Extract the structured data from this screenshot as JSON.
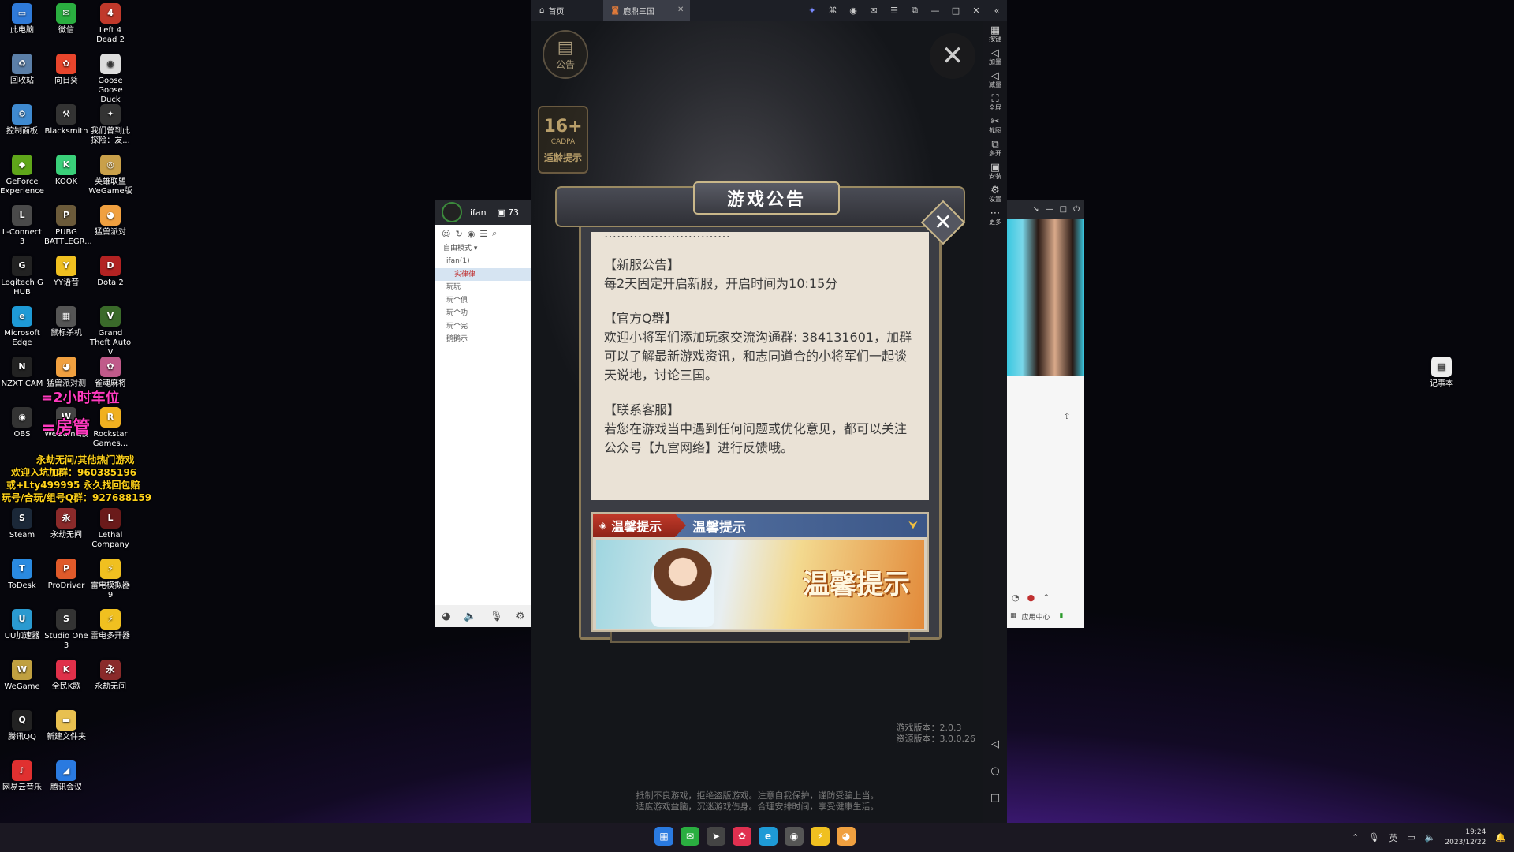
{
  "desktop": {
    "icons": [
      {
        "label": "此电脑",
        "glyph": "▭",
        "color": "#2f7ad8"
      },
      {
        "label": "微信",
        "glyph": "✉",
        "color": "#2aae40"
      },
      {
        "label": "Left 4 Dead 2",
        "glyph": "4",
        "color": "#c0392b"
      },
      {
        "label": "回收站",
        "glyph": "♻",
        "color": "#5b7fa8"
      },
      {
        "label": "向日葵",
        "glyph": "✿",
        "color": "#e8452c"
      },
      {
        "label": "Goose Goose Duck",
        "glyph": "◉",
        "color": "#ddd"
      },
      {
        "label": "控制面板",
        "glyph": "⚙",
        "color": "#3f8ad0"
      },
      {
        "label": "Blacksmith",
        "glyph": "⚒",
        "color": "#333"
      },
      {
        "label": "我们曾到此探险：友...",
        "glyph": "✦",
        "color": "#333"
      },
      {
        "label": "GeForce Experience",
        "glyph": "◆",
        "color": "#5fa61a"
      },
      {
        "label": "KOOK",
        "glyph": "K",
        "color": "#3ad07a"
      },
      {
        "label": "英雄联盟WeGame版",
        "glyph": "◎",
        "color": "#c9a04a"
      },
      {
        "label": "L-Connect 3",
        "glyph": "L",
        "color": "#4a4a4a"
      },
      {
        "label": "PUBG BATTLEGR...",
        "glyph": "P",
        "color": "#6b5a3a"
      },
      {
        "label": "猛兽派对",
        "glyph": "◕",
        "color": "#f0a040"
      },
      {
        "label": "Logitech G HUB",
        "glyph": "G",
        "color": "#222"
      },
      {
        "label": "YY语音",
        "glyph": "Y",
        "color": "#f0c020"
      },
      {
        "label": "Dota 2",
        "glyph": "D",
        "color": "#b22222"
      },
      {
        "label": "Microsoft Edge",
        "glyph": "e",
        "color": "#1e9ad6"
      },
      {
        "label": "鼠标杀机",
        "glyph": "▦",
        "color": "#555"
      },
      {
        "label": "Grand Theft Auto V",
        "glyph": "V",
        "color": "#3a6a2a"
      },
      {
        "label": "NZXT CAM",
        "glyph": "N",
        "color": "#222"
      },
      {
        "label": "猛兽派对测",
        "glyph": "◕",
        "color": "#f0a040"
      },
      {
        "label": "雀魂麻将",
        "glyph": "✿",
        "color": "#c05a8a"
      },
      {
        "label": "OBS",
        "glyph": "◉",
        "color": "#333"
      },
      {
        "label": "WeGame版",
        "glyph": "W",
        "color": "#444"
      },
      {
        "label": "Rockstar Games...",
        "glyph": "R",
        "color": "#f0b020"
      },
      {
        "label": "Steam",
        "glyph": "S",
        "color": "#1b2838"
      },
      {
        "label": "永劫无间",
        "glyph": "永",
        "color": "#8a2a2a"
      },
      {
        "label": "Lethal Company",
        "glyph": "L",
        "color": "#6a1a1a"
      },
      {
        "label": "ToDesk",
        "glyph": "T",
        "color": "#2a8ae0"
      },
      {
        "label": "ProDriver",
        "glyph": "P",
        "color": "#e05a2a"
      },
      {
        "label": "雷电模拟器9",
        "glyph": "⚡",
        "color": "#f0c020"
      },
      {
        "label": "UU加速器",
        "glyph": "U",
        "color": "#2a9ad0"
      },
      {
        "label": "Studio One 3",
        "glyph": "S",
        "color": "#333"
      },
      {
        "label": "雷电多开器",
        "glyph": "⚡",
        "color": "#f0c020"
      },
      {
        "label": "WeGame",
        "glyph": "W",
        "color": "#c0a040"
      },
      {
        "label": "全民K歌",
        "glyph": "K",
        "color": "#e0304a"
      },
      {
        "label": "永劫无间",
        "glyph": "永",
        "color": "#8a2a2a"
      },
      {
        "label": "腾讯QQ",
        "glyph": "Q",
        "color": "#222"
      },
      {
        "label": "新建文件夹",
        "glyph": "▬",
        "color": "#e8c050"
      },
      {
        "label": "网易云音乐",
        "glyph": "♪",
        "color": "#e03030"
      },
      {
        "label": "腾讯会议",
        "glyph": "◢",
        "color": "#2a7ae0"
      }
    ],
    "notepad": {
      "label": "记事本",
      "glyph": "▤",
      "color": "#eee"
    },
    "overlays": {
      "line1": "=2小时车位",
      "line2": "=房管",
      "line3": "永劫无间/其他热门游戏",
      "line4": "欢迎入坑加群：960385196",
      "line5": "或+Lty499995 永久找回包赔",
      "line6": "玩号/合玩/组号Q群：927688159"
    }
  },
  "emulator": {
    "home_tab": "首页",
    "game_tab": "鹿鼎三国",
    "sidebar": [
      "按键",
      "加量",
      "减量",
      "全屏",
      "截图",
      "多开",
      "安装",
      "设置",
      "更多"
    ],
    "game": {
      "notice_label": "公告",
      "age_rating": {
        "number": "16+",
        "org": "CADPA",
        "label": "适龄提示"
      },
      "dialog": {
        "title": "游戏公告",
        "cut_line": "…………………………",
        "sections": [
          {
            "title": "【新服公告】",
            "body": "每2天固定开启新服，开启时间为10:15分"
          },
          {
            "title": "【官方Q群】",
            "body": "欢迎小将军们添加玩家交流沟通群: 384131601，加群可以了解最新游戏资讯，和志同道合的小将军们一起谈天说地，讨论三国。"
          },
          {
            "title": "【联系客服】",
            "body": "若您在游戏当中遇到任何问题或优化意见，都可以关注公众号【九宫网络】进行反馈哦。"
          }
        ],
        "tab_active": "温馨提示",
        "tab_title": "温馨提示",
        "banner_text": "温馨提示"
      },
      "version": {
        "game": "游戏版本：2.0.3",
        "resource": "资源版本：3.0.0.26"
      },
      "footer": {
        "line1": "抵制不良游戏，拒绝盗版游戏。注意自我保护，谨防受骗上当。",
        "line2": "适度游戏益脑，沉迷游戏伤身。合理安排时间，享受健康生活。"
      }
    }
  },
  "chat": {
    "username": "ifan",
    "count": "73",
    "mode": "自由模式",
    "tree": [
      "ifan(1)",
      "实律律",
      "玩玩",
      "玩个俱",
      "玩个功",
      "玩个完",
      "鹅鹅示"
    ]
  },
  "rightapp": {
    "bottom_label": "应用中心"
  },
  "taskbar": {
    "icons": [
      {
        "g": "▦",
        "c": "#2a7ae0"
      },
      {
        "g": "✉",
        "c": "#2aae40"
      },
      {
        "g": "➤",
        "c": "#444"
      },
      {
        "g": "✿",
        "c": "#e03050"
      },
      {
        "g": "e",
        "c": "#1e9ad6"
      },
      {
        "g": "◉",
        "c": "#555"
      },
      {
        "g": "⚡",
        "c": "#f0c020"
      },
      {
        "g": "◕",
        "c": "#f0a040"
      }
    ],
    "ime": "英",
    "time": "19:24",
    "date": "2023/12/22"
  }
}
